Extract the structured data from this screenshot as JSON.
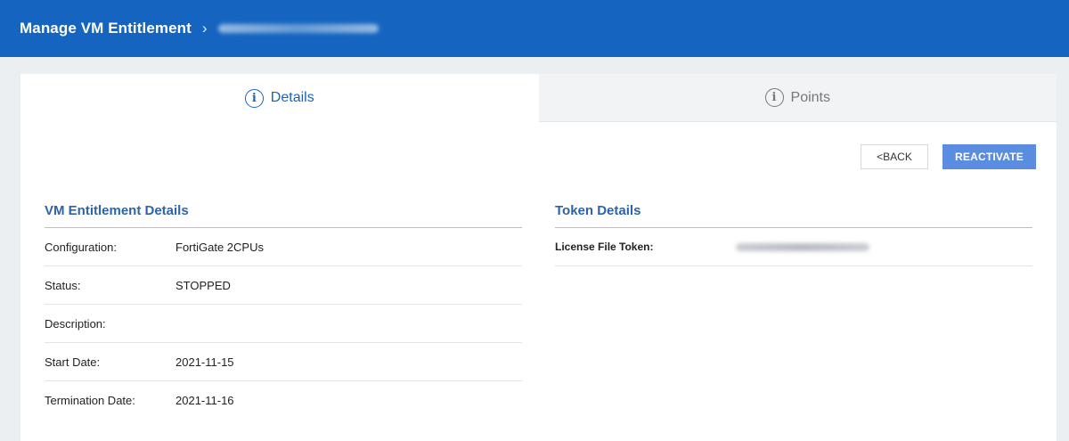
{
  "breadcrumb": {
    "title": "Manage VM Entitlement",
    "separator": "›",
    "current": ""
  },
  "tabs": [
    {
      "label": "Details",
      "active": true
    },
    {
      "label": "Points",
      "active": false
    }
  ],
  "actions": {
    "back_label": "<BACK",
    "reactivate_label": "REACTIVATE"
  },
  "vm_details": {
    "title": "VM Entitlement Details",
    "rows": [
      {
        "label": "Configuration:",
        "value": "FortiGate 2CPUs"
      },
      {
        "label": "Status:",
        "value": "STOPPED"
      },
      {
        "label": "Description:",
        "value": ""
      },
      {
        "label": "Start Date:",
        "value": "2021-11-15"
      },
      {
        "label": "Termination Date:",
        "value": "2021-11-16"
      }
    ]
  },
  "token_details": {
    "title": "Token Details",
    "rows": [
      {
        "label": "License File Token:",
        "value": ""
      }
    ]
  },
  "colors": {
    "header": "#1565c0",
    "accent": "#2e63a8",
    "button": "#5a8de0"
  }
}
